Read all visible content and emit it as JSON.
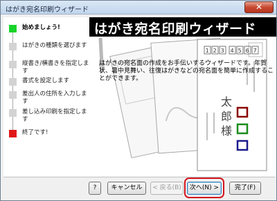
{
  "window": {
    "title": "はがき宛名印刷ウィザード",
    "close_label": "✕"
  },
  "steps": [
    {
      "label": "始めましょう!",
      "state": "start"
    },
    {
      "label": "はがきの種類を選びます",
      "state": "pending"
    },
    {
      "label": "縦書き/横書きを指定します",
      "state": "pending"
    },
    {
      "label": "書式を設定します",
      "state": "pending"
    },
    {
      "label": "差出人の住所を入力します",
      "state": "pending"
    },
    {
      "label": "差し込み印刷を指定します",
      "state": "pending"
    },
    {
      "label": "終了です!",
      "state": "end"
    }
  ],
  "banner": {
    "title": "はがき宛名印刷ウィザード"
  },
  "description": "はがきの宛名面の作成をお手伝いするウィザードです。年賀状、暑中見舞い、往復はがきなどの宛名面を簡単に作成することができます。",
  "illustration": {
    "postal_code": "1234567",
    "addressee": "太郎様",
    "color_boxes": [
      "#8b0000",
      "#1a8c1a",
      "#1a1a8c"
    ]
  },
  "buttons": {
    "help": "?",
    "cancel": "キャンセル",
    "back": "< 戻る(B)",
    "next": "次へ(N) >",
    "finish": "完了(F)"
  }
}
